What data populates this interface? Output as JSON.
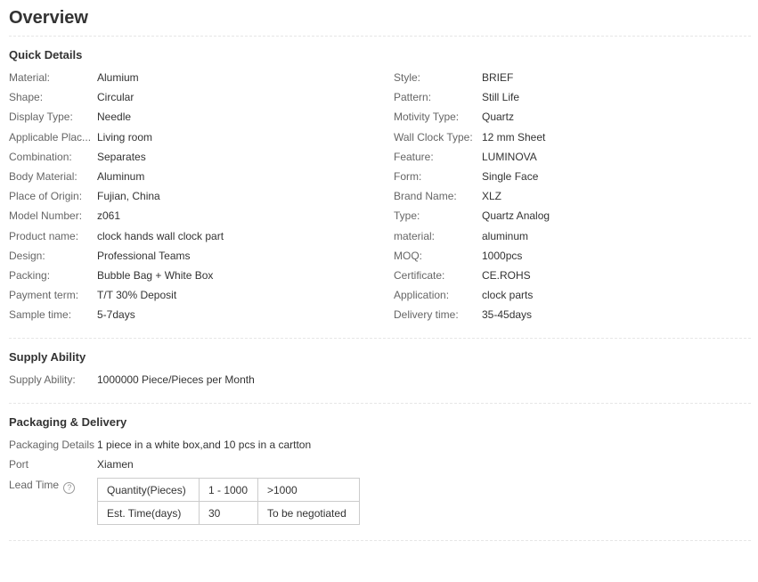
{
  "overview": {
    "title": "Overview"
  },
  "quick_details": {
    "title": "Quick Details",
    "left": [
      {
        "label": "Material:",
        "value": "Alumium"
      },
      {
        "label": "Shape:",
        "value": "Circular"
      },
      {
        "label": "Display Type:",
        "value": "Needle"
      },
      {
        "label": "Applicable Plac...",
        "value": "Living room"
      },
      {
        "label": "Combination:",
        "value": "Separates"
      },
      {
        "label": "Body Material:",
        "value": "Aluminum"
      },
      {
        "label": "Place of Origin:",
        "value": "Fujian, China"
      },
      {
        "label": "Model Number:",
        "value": "z061"
      },
      {
        "label": "Product name:",
        "value": "clock hands wall clock part"
      },
      {
        "label": "Design:",
        "value": "Professional Teams"
      },
      {
        "label": "Packing:",
        "value": "Bubble Bag + White Box"
      },
      {
        "label": "Payment term:",
        "value": "T/T 30% Deposit"
      },
      {
        "label": "Sample time:",
        "value": "5-7days"
      }
    ],
    "right": [
      {
        "label": "Style:",
        "value": "BRIEF"
      },
      {
        "label": "Pattern:",
        "value": "Still Life"
      },
      {
        "label": "Motivity Type:",
        "value": "Quartz"
      },
      {
        "label": "Wall Clock Type:",
        "value": "12 mm Sheet"
      },
      {
        "label": "Feature:",
        "value": "LUMINOVA"
      },
      {
        "label": "Form:",
        "value": "Single Face"
      },
      {
        "label": "Brand Name:",
        "value": "XLZ"
      },
      {
        "label": "Type:",
        "value": "Quartz Analog"
      },
      {
        "label": "material:",
        "value": "aluminum"
      },
      {
        "label": "MOQ:",
        "value": "1000pcs"
      },
      {
        "label": "Certificate:",
        "value": "CE.ROHS"
      },
      {
        "label": "Application:",
        "value": "clock parts"
      },
      {
        "label": "Delivery time:",
        "value": "35-45days"
      }
    ]
  },
  "supply_ability": {
    "title": "Supply Ability",
    "label": "Supply Ability:",
    "value": "1000000 Piece/Pieces per Month"
  },
  "packaging": {
    "title": "Packaging & Delivery",
    "details_label": "Packaging Details",
    "details_value": "1 piece in a white box,and 10 pcs in a cartton",
    "port_label": "Port",
    "port_value": "Xiamen",
    "lead_time_label": "Lead Time",
    "help_glyph": "?",
    "lead_table": [
      [
        "Quantity(Pieces)",
        "1 - 1000",
        ">1000"
      ],
      [
        "Est. Time(days)",
        "30",
        "To be negotiated"
      ]
    ]
  },
  "icons": {
    "lead_time_help": "question-circle-icon"
  }
}
